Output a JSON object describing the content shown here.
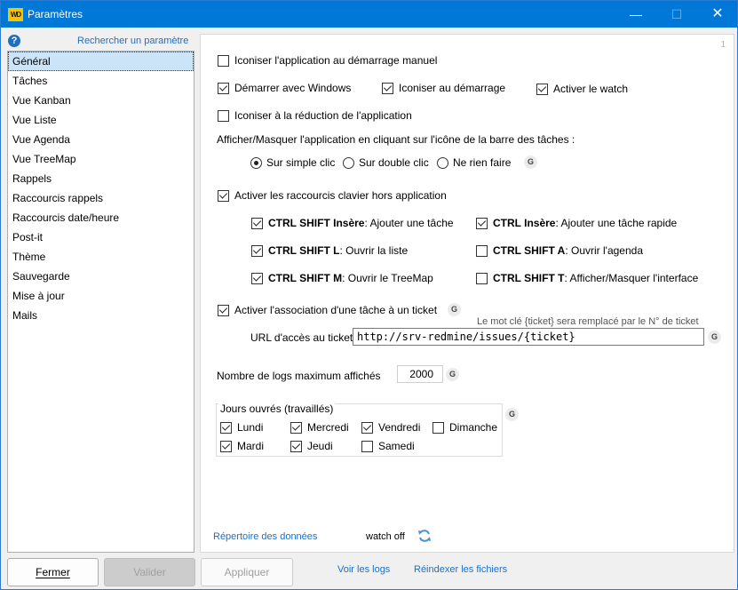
{
  "window": {
    "title": "Paramètres",
    "app_icon": "WD"
  },
  "sidebar": {
    "search_link": "Rechercher un paramètre",
    "items": [
      {
        "label": "Général",
        "selected": true
      },
      {
        "label": "Tâches"
      },
      {
        "label": "Vue Kanban"
      },
      {
        "label": "Vue Liste"
      },
      {
        "label": "Vue Agenda"
      },
      {
        "label": "Vue TreeMap"
      },
      {
        "label": "Rappels"
      },
      {
        "label": "Raccourcis rappels"
      },
      {
        "label": "Raccourcis date/heure"
      },
      {
        "label": "Post-it"
      },
      {
        "label": "Thème"
      },
      {
        "label": "Sauvegarde"
      },
      {
        "label": "Mise à jour"
      },
      {
        "label": "Mails"
      }
    ]
  },
  "general": {
    "page_number": "1",
    "iconise_manual": {
      "label": "Iconiser l'application au démarrage manuel",
      "checked": false
    },
    "start_windows": {
      "label": "Démarrer avec Windows",
      "checked": true
    },
    "iconise_start": {
      "label": "Iconiser au démarrage",
      "checked": true
    },
    "activate_watch": {
      "label": "Activer le watch",
      "checked": true
    },
    "iconise_reduce": {
      "label": "Iconiser à la réduction de l'application",
      "checked": false
    },
    "taskbar_label": "Afficher/Masquer l'application en cliquant sur l'icône de la barre des tâches :",
    "taskbar_options": [
      {
        "label": "Sur simple clic",
        "selected": true
      },
      {
        "label": "Sur double clic",
        "selected": false
      },
      {
        "label": "Ne rien faire",
        "selected": false
      }
    ],
    "g_badge": "G",
    "hotkeys_enable": {
      "label": "Activer les raccourcis clavier hors application",
      "checked": true
    },
    "hotkeys": [
      {
        "keys": "CTRL SHIFT Insère",
        "action": " : Ajouter une tâche",
        "checked": true
      },
      {
        "keys": "CTRL Insère",
        "action": " : Ajouter une tâche rapide",
        "checked": true
      },
      {
        "keys": "CTRL SHIFT L",
        "action": " : Ouvrir la liste",
        "checked": true
      },
      {
        "keys": "CTRL SHIFT A",
        "action": " : Ouvrir l'agenda",
        "checked": false
      },
      {
        "keys": "CTRL SHIFT M",
        "action": " : Ouvrir le TreeMap",
        "checked": true
      },
      {
        "keys": "CTRL SHIFT T",
        "action": " : Afficher/Masquer l'interface",
        "checked": false
      }
    ],
    "ticket_assoc": {
      "label": "Activer l'association d'une tâche à un ticket",
      "checked": true
    },
    "ticket_hint": "Le mot clé {ticket} sera remplacé par le N° de ticket",
    "ticket_url_label": "URL d'accès au ticket",
    "ticket_url_value": "http://srv-redmine/issues/{ticket}",
    "logs_label": "Nombre de logs maximum affichés",
    "logs_value": "2000",
    "workdays_title": "Jours ouvrés (travaillés)",
    "workdays": [
      {
        "label": "Lundi",
        "checked": true
      },
      {
        "label": "Mercredi",
        "checked": true
      },
      {
        "label": "Vendredi",
        "checked": true
      },
      {
        "label": "Dimanche",
        "checked": false
      },
      {
        "label": "Mardi",
        "checked": true
      },
      {
        "label": "Jeudi",
        "checked": true
      },
      {
        "label": "Samedi",
        "checked": false
      }
    ],
    "data_dir_link": "Répertoire des données",
    "watch_status": "watch off"
  },
  "footer": {
    "close": "Fermer",
    "validate": "Valider",
    "apply": "Appliquer",
    "view_logs": "Voir les logs",
    "reindex": "Réindexer les fichiers"
  }
}
